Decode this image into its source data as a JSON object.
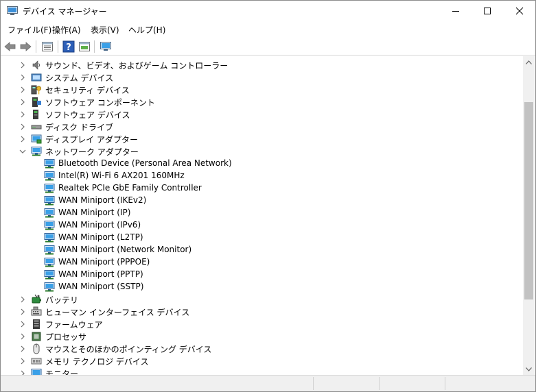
{
  "window": {
    "title": "デバイス マネージャー",
    "buttons": {
      "minimize": "minimize",
      "maximize": "maximize",
      "close": "close"
    }
  },
  "menu": {
    "items": [
      "ファイル(F)",
      "操作(A)",
      "表示(V)",
      "ヘルプ(H)"
    ]
  },
  "toolbar": {
    "icons": [
      "back-arrow-icon",
      "forward-arrow-icon",
      "properties-icon",
      "help-icon",
      "view-icon",
      "monitor-icon"
    ]
  },
  "tree": {
    "rows": [
      {
        "label": "サウンド、ビデオ、およびゲーム コントローラー",
        "level": 0,
        "expanded": false,
        "icon": "speaker-icon"
      },
      {
        "label": "システム デバイス",
        "level": 0,
        "expanded": false,
        "icon": "system-device-icon"
      },
      {
        "label": "セキュリティ デバイス",
        "level": 0,
        "expanded": false,
        "icon": "security-device-icon"
      },
      {
        "label": "ソフトウェア コンポーネント",
        "level": 0,
        "expanded": false,
        "icon": "software-component-icon"
      },
      {
        "label": "ソフトウェア デバイス",
        "level": 0,
        "expanded": false,
        "icon": "software-device-icon"
      },
      {
        "label": "ディスク ドライブ",
        "level": 0,
        "expanded": false,
        "icon": "disk-drive-icon"
      },
      {
        "label": "ディスプレイ アダプター",
        "level": 0,
        "expanded": false,
        "icon": "display-adapter-icon"
      },
      {
        "label": "ネットワーク アダプター",
        "level": 0,
        "expanded": true,
        "icon": "network-adapter-icon"
      },
      {
        "label": "Bluetooth Device (Personal Area Network)",
        "level": 1,
        "icon": "network-adapter-icon"
      },
      {
        "label": "Intel(R) Wi-Fi 6 AX201 160MHz",
        "level": 1,
        "icon": "network-adapter-icon"
      },
      {
        "label": "Realtek PCIe GbE Family Controller",
        "level": 1,
        "icon": "network-adapter-icon"
      },
      {
        "label": "WAN Miniport (IKEv2)",
        "level": 1,
        "icon": "network-adapter-icon"
      },
      {
        "label": "WAN Miniport (IP)",
        "level": 1,
        "icon": "network-adapter-icon"
      },
      {
        "label": "WAN Miniport (IPv6)",
        "level": 1,
        "icon": "network-adapter-icon"
      },
      {
        "label": "WAN Miniport (L2TP)",
        "level": 1,
        "icon": "network-adapter-icon"
      },
      {
        "label": "WAN Miniport (Network Monitor)",
        "level": 1,
        "icon": "network-adapter-icon"
      },
      {
        "label": "WAN Miniport (PPPOE)",
        "level": 1,
        "icon": "network-adapter-icon"
      },
      {
        "label": "WAN Miniport (PPTP)",
        "level": 1,
        "icon": "network-adapter-icon"
      },
      {
        "label": "WAN Miniport (SSTP)",
        "level": 1,
        "icon": "network-adapter-icon"
      },
      {
        "label": "バッテリ",
        "level": 0,
        "expanded": false,
        "icon": "battery-icon"
      },
      {
        "label": "ヒューマン インターフェイス デバイス",
        "level": 0,
        "expanded": false,
        "icon": "hid-icon"
      },
      {
        "label": "ファームウェア",
        "level": 0,
        "expanded": false,
        "icon": "firmware-icon"
      },
      {
        "label": "プロセッサ",
        "level": 0,
        "expanded": false,
        "icon": "processor-icon"
      },
      {
        "label": "マウスとそのほかのポインティング デバイス",
        "level": 0,
        "expanded": false,
        "icon": "mouse-icon"
      },
      {
        "label": "メモリ テクノロジ デバイス",
        "level": 0,
        "expanded": false,
        "icon": "memory-icon"
      },
      {
        "label": "モニター",
        "level": 0,
        "expanded": false,
        "icon": "monitor-icon"
      }
    ]
  },
  "scrollbar": {
    "position": 0.35
  },
  "colors": {
    "network_blue": "#2f7fd6",
    "screen_blue": "#3aa0e8",
    "chevron": "#6b6b6b",
    "scroll_thumb": "#c2c2c2"
  }
}
